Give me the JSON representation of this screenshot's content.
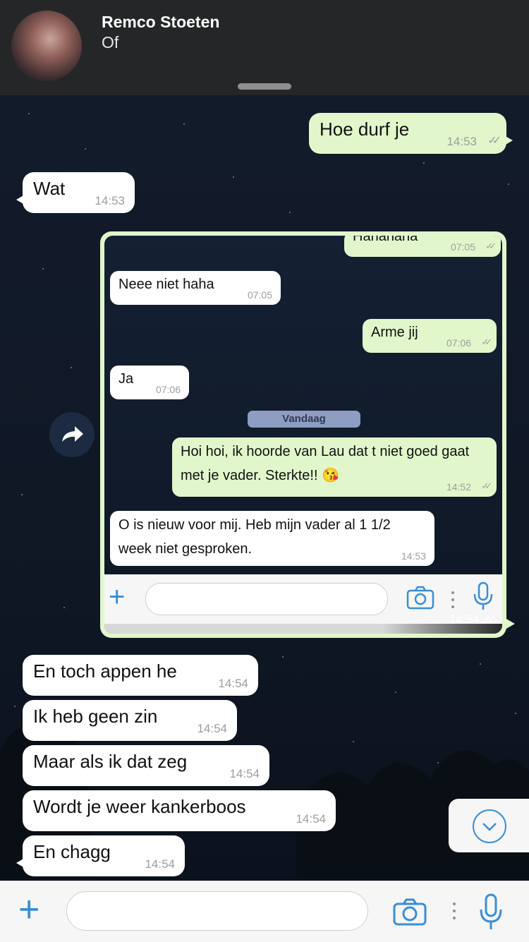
{
  "header": {
    "contact_name": "Remco Stoeten",
    "contact_status": "Of"
  },
  "messages": [
    {
      "text": "Hoe durf je",
      "time": "14:53",
      "direction": "outgoing",
      "read": true
    },
    {
      "text": "Wat",
      "time": "14:53",
      "direction": "incoming"
    },
    {
      "text": "En toch appen he",
      "time": "14:54",
      "direction": "incoming"
    },
    {
      "text": "Ik heb geen zin",
      "time": "14:54",
      "direction": "incoming"
    },
    {
      "text": "Maar als ik dat zeg",
      "time": "14:54",
      "direction": "incoming"
    },
    {
      "text": "Wordt je weer kankerboos",
      "time": "14:54",
      "direction": "incoming"
    },
    {
      "text": "En chagg",
      "time": "14:54",
      "direction": "incoming"
    }
  ],
  "screenshot_message": {
    "time": "14:54",
    "read": true,
    "inner_messages": [
      {
        "text": "Hahahaha",
        "time": "07:05",
        "direction": "outgoing"
      },
      {
        "text": "Neee niet haha",
        "time": "07:05",
        "direction": "incoming"
      },
      {
        "text": "Arme jij",
        "time": "07:06",
        "direction": "outgoing"
      },
      {
        "text": "Ja",
        "time": "07:06",
        "direction": "incoming"
      },
      {
        "text": "Hoi hoi, ik hoorde van Lau dat t niet goed gaat met je vader. Sterkte!! 😘",
        "time": "14:52",
        "direction": "outgoing"
      },
      {
        "text": "O is nieuw voor mij. Heb mijn vader al 1 1/2 week niet gesproken.",
        "time": "14:53",
        "direction": "incoming"
      }
    ],
    "date_divider": "Vandaag"
  },
  "input_bar": {
    "placeholder": ""
  },
  "icons": {
    "attach": "plus-icon",
    "camera": "camera-icon",
    "mic": "microphone-icon",
    "forward": "forward-icon",
    "scroll": "chevron-down-icon",
    "read": "double-check-icon"
  },
  "colors": {
    "outgoing_bubble": "#e1f7cb",
    "incoming_bubble": "#ffffff",
    "accent": "#3a8ed6",
    "header": "#262628"
  }
}
